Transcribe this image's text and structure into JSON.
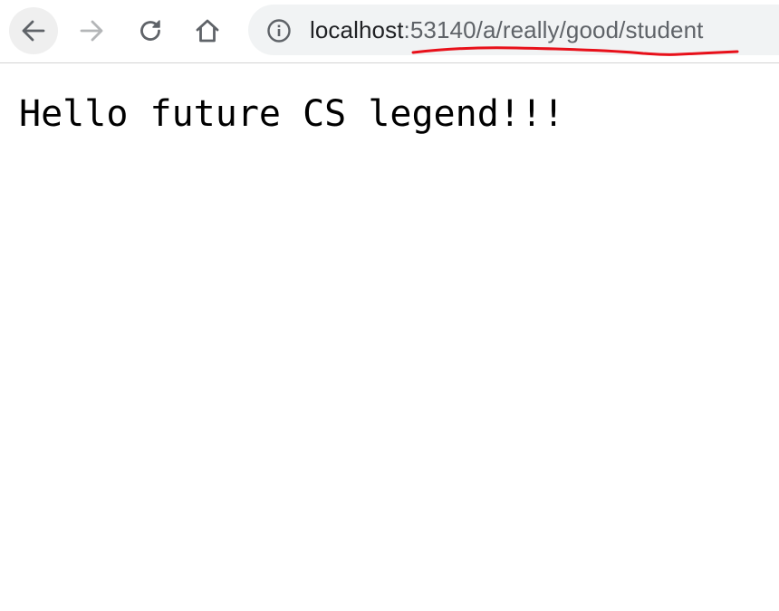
{
  "toolbar": {
    "back_icon": "arrow-left-icon",
    "forward_icon": "arrow-right-icon",
    "reload_icon": "reload-icon",
    "home_icon": "home-icon"
  },
  "omnibox": {
    "info_icon": "info-icon",
    "host": "localhost",
    "path": ":53140/a/really/good/student"
  },
  "page": {
    "message": "Hello future CS legend!!!"
  },
  "colors": {
    "annotation": "#e8101a",
    "omnibox_bg": "#f1f3f4",
    "back_button_bg": "#efefef"
  }
}
